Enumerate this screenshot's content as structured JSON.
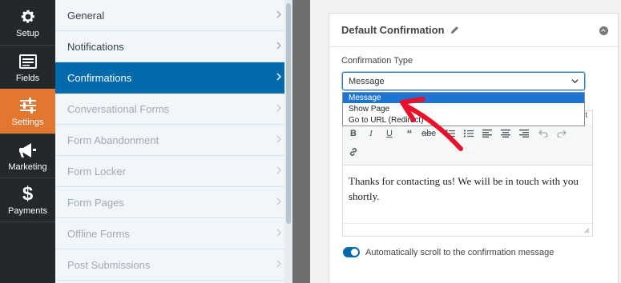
{
  "leftnav": {
    "items": [
      {
        "label": "Setup",
        "icon": "gear-icon"
      },
      {
        "label": "Fields",
        "icon": "fields-icon"
      },
      {
        "label": "Settings",
        "icon": "sliders-icon",
        "active": true
      },
      {
        "label": "Marketing",
        "icon": "megaphone-icon"
      },
      {
        "label": "Payments",
        "icon": "dollar-icon"
      }
    ],
    "active_color": "#e27730",
    "bg_color": "#23282d"
  },
  "menu": {
    "items": [
      {
        "label": "General"
      },
      {
        "label": "Notifications"
      },
      {
        "label": "Confirmations",
        "active": true
      },
      {
        "label": "Conversational Forms",
        "disabled": true
      },
      {
        "label": "Form Abandonment",
        "disabled": true
      },
      {
        "label": "Form Locker",
        "disabled": true
      },
      {
        "label": "Form Pages",
        "disabled": true
      },
      {
        "label": "Offline Forms",
        "disabled": true
      },
      {
        "label": "Post Submissions",
        "disabled": true
      }
    ],
    "active_color": "#036aab"
  },
  "panel": {
    "title": "Default Confirmation",
    "confirmation_type_label": "Confirmation Type",
    "select_value": "Message",
    "dropdown_options": [
      "Message",
      "Show Page",
      "Go to URL (Redirect)"
    ],
    "editor_message": "Thanks for contacting us! We will be in touch with you shortly.",
    "toolbar_corner": "t",
    "toggle_label": "Automatically scroll to the confirmation message",
    "toggle_on": true
  }
}
